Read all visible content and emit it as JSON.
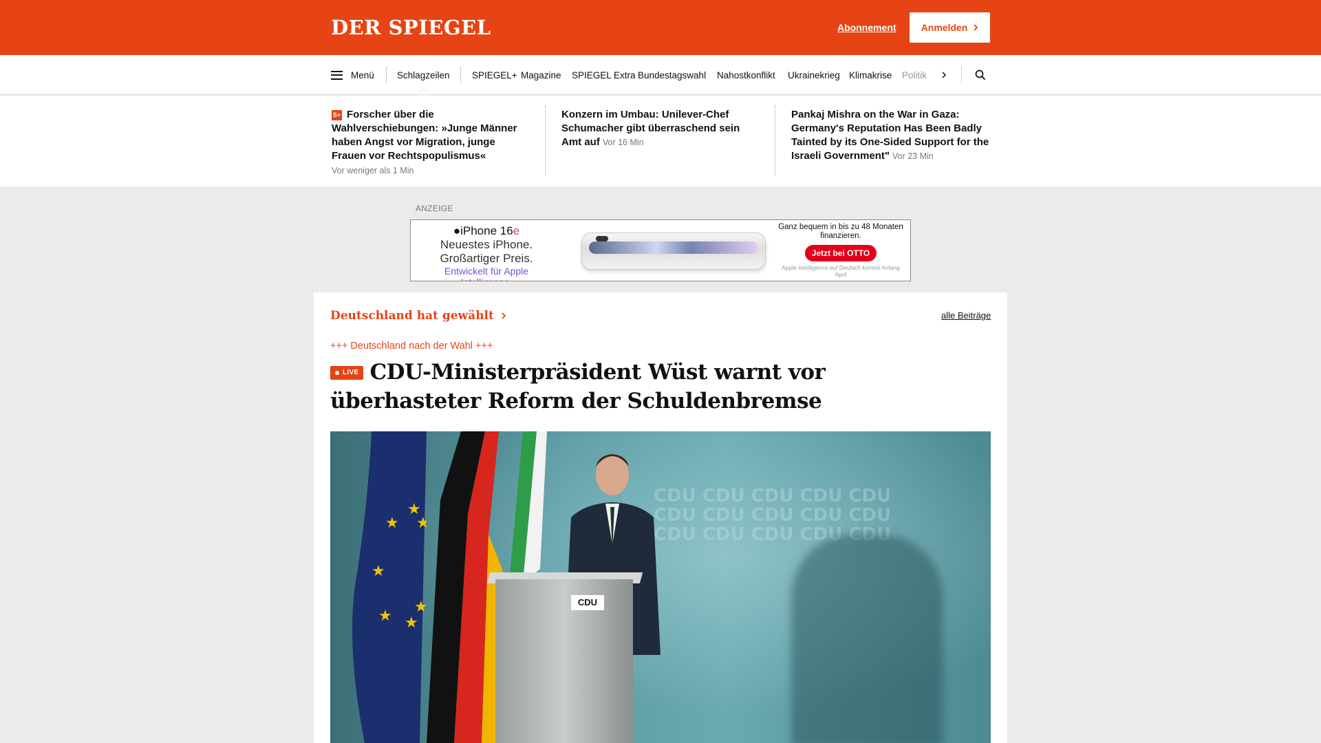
{
  "brand": {
    "logo": "DER SPIEGEL"
  },
  "header": {
    "abo_label": "Abonnement",
    "login_label": "Anmelden"
  },
  "nav": {
    "menu_label": "Menü",
    "items": [
      "Schlagzeilen",
      "SPIEGEL+",
      "Magazine",
      "SPIEGEL Extra",
      "Bundestagswahl",
      "Nahostkonflikt",
      "Ukrainekrieg",
      "Klimakrise",
      "Politik"
    ],
    "icons": [
      "menu-icon",
      "chevron-right-icon",
      "search-icon"
    ]
  },
  "ticker": [
    {
      "badge": "S+",
      "title": "Forscher über die Wahlverschiebungen: »Junge Männer haben Angst vor Migration, junge Frauen vor Rechtspopulismus«",
      "time": "Vor weniger als 1 Min"
    },
    {
      "title": "Konzern im Umbau: Unilever-Chef Schumacher gibt überraschend sein Amt auf",
      "time": "Vor 16 Min"
    },
    {
      "title": "Pankaj Mishra on the War in Gaza: Germany's Reputation Has Been Badly Tainted by its One-Sided Support for the Israeli Government\"",
      "time": "Vor 23 Min"
    }
  ],
  "ad": {
    "label": "ANZEIGE",
    "product": "iPhone 16",
    "product_suffix": "e",
    "tag1": "Neuestes iPhone.",
    "tag2": "Großartiger Preis.",
    "tag3": "Entwickelt für Apple Intelligence.",
    "right_text": "Ganz bequem in bis zu 48 Monaten finanzieren.",
    "cta": "Jetzt bei OTTO",
    "fine_print": "Apple Intelligence auf Deutsch kommt Anfang April"
  },
  "section": {
    "title": "Deutschland hat gewählt",
    "all_link": "alle Beiträge"
  },
  "article": {
    "kicker": "+++ Deutschland nach der Wahl +++",
    "live_label": "LIVE",
    "headline": "CDU-Ministerpräsident Wüst warnt vor überhasteter Reform der Schuldenbremse",
    "podium_logo": "CDU",
    "backdrop_text": "CDU"
  },
  "colors": {
    "brand": "#e64415",
    "background": "#ecebea"
  }
}
